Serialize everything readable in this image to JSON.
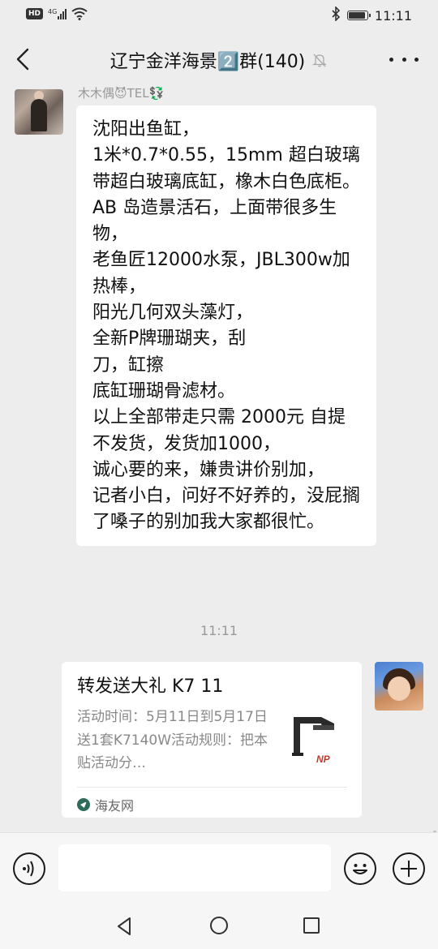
{
  "status_bar": {
    "hd_badge": "HD",
    "network": "4G",
    "time": "11:11",
    "battery_level": 0.85
  },
  "header": {
    "title": "辽宁金洋海景2️⃣群(140)",
    "back_icon": "chevron-left-icon",
    "mute_icon": "bell-muted-icon",
    "more_icon": "more-dots-icon"
  },
  "messages": [
    {
      "sender": "木木偶😈TEL💱",
      "lines": [
        "沈阳出鱼缸，",
        "1米*0.7*0.55，15mm 超白玻璃带超白玻璃底缸，橡木白色底柜。",
        "AB 岛造景活石，上面带很多生物，",
        "老鱼匠12000水泵，JBL300w加热棒，",
        "阳光几何双头藻灯，",
        "全新P牌珊瑚夹，刮",
        "刀，缸擦",
        "底缸珊瑚骨滤材。",
        "以上全部带走只需 2000元 自提不发货，发货加1000，",
        "诚心要的来，嫌贵讲价别加，",
        "记者小白，问好不好养的，没屁搁了嗓子的别加我大家都很忙。"
      ]
    }
  ],
  "timestamp": "11:11",
  "shared_card": {
    "title": "转发送大礼 K7 11",
    "description": "活动时间：5月11日到5月17日送1套K7140W活动规则：把本贴活动分…",
    "source": "海友网",
    "source_icon": "haiyou-logo-icon",
    "thumbnail_icon": "k7-lamp-thumbnail",
    "thumbnail_brand": "NP"
  },
  "input_bar": {
    "text_value": "",
    "voice_icon": "voice-icon",
    "emoji_icon": "emoji-icon",
    "plus_icon": "plus-icon"
  },
  "nav_bar": {
    "back_icon": "triangle-back-icon",
    "home_icon": "circle-home-icon",
    "recent_icon": "square-recent-icon"
  }
}
